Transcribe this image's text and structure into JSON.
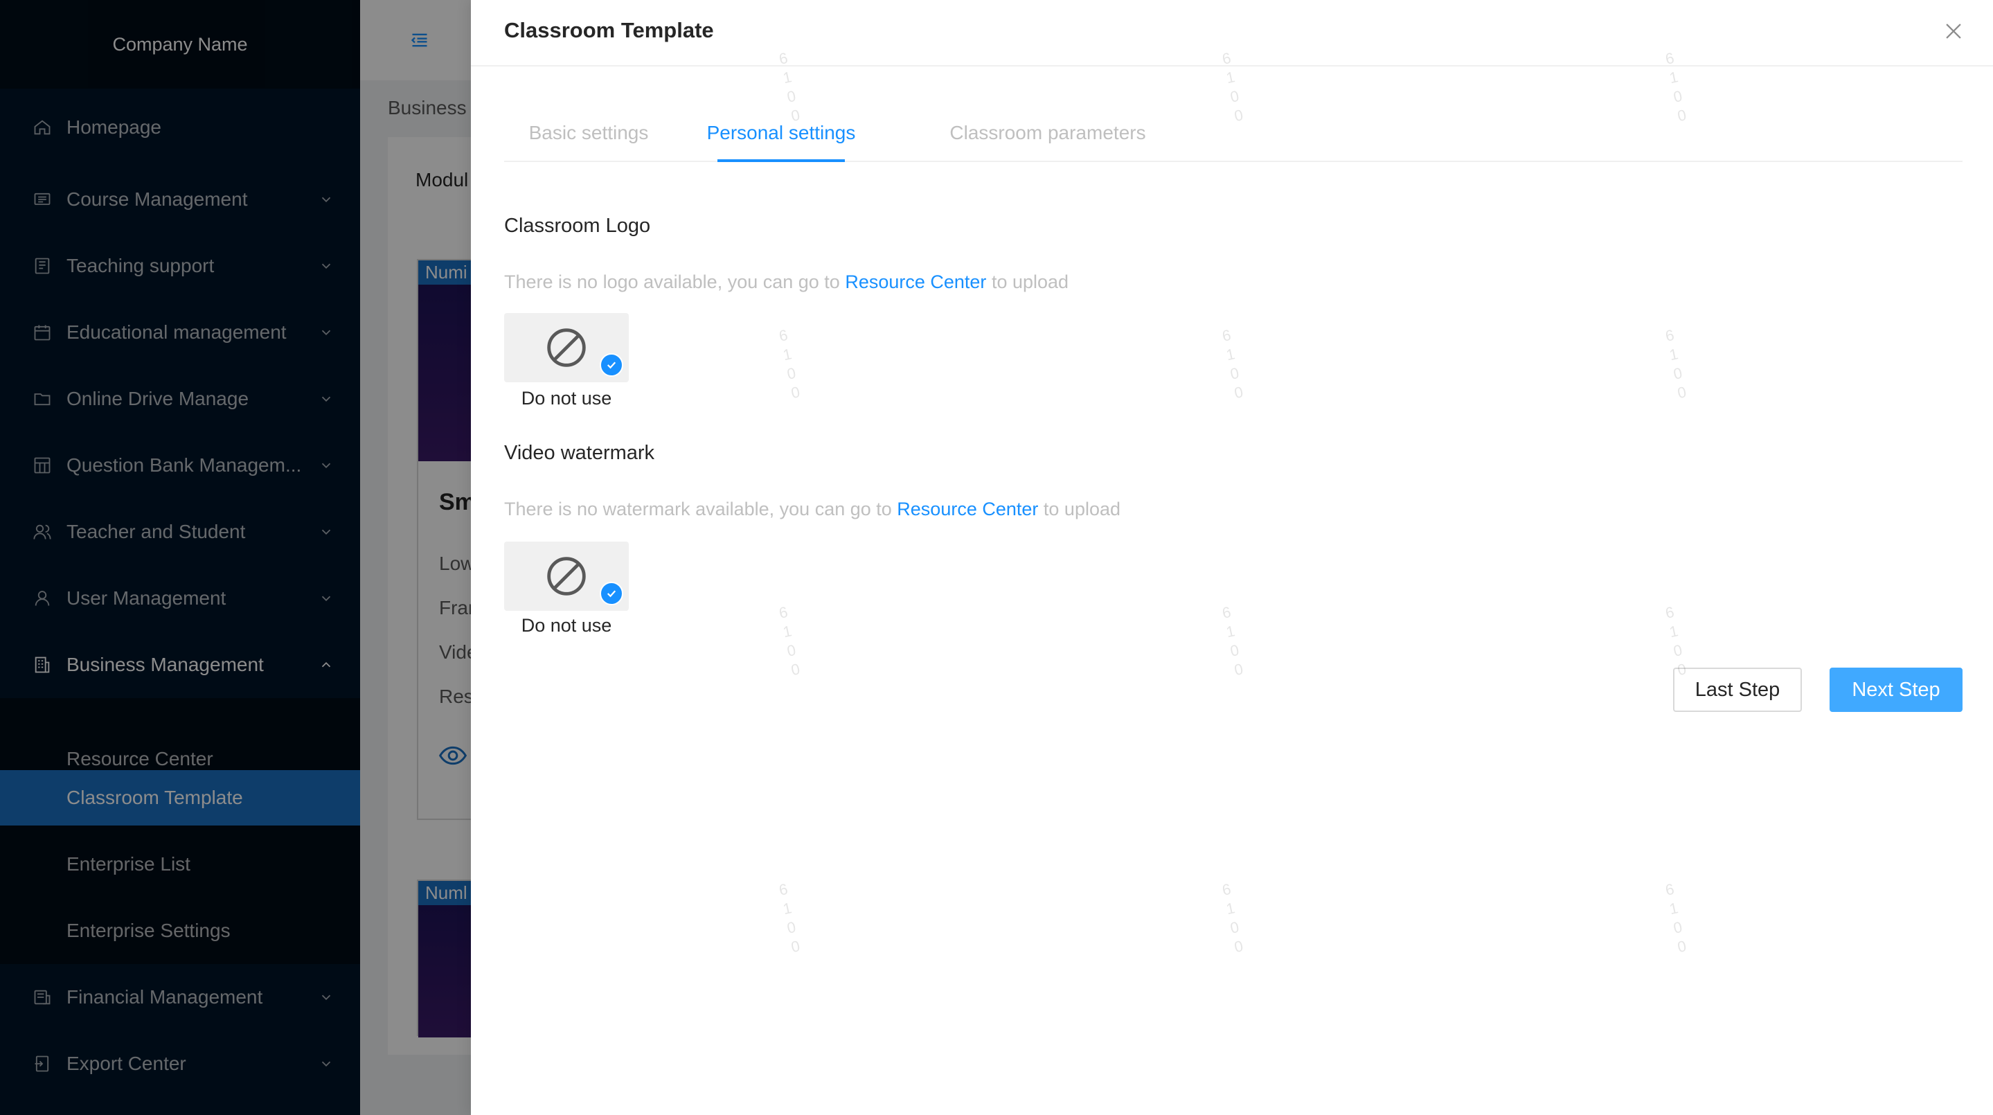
{
  "sidebar": {
    "company_name": "Company Name",
    "items": [
      {
        "label": "Homepage",
        "icon": "home-icon"
      },
      {
        "label": "Course Management",
        "icon": "course-icon"
      },
      {
        "label": "Teaching support",
        "icon": "teaching-icon"
      },
      {
        "label": "Educational management",
        "icon": "calendar-icon"
      },
      {
        "label": "Online Drive Manage",
        "icon": "folder-icon"
      },
      {
        "label": "Question Bank Managem...",
        "icon": "question-bank-icon"
      },
      {
        "label": "Teacher and Student",
        "icon": "people-icon"
      },
      {
        "label": "User Management",
        "icon": "user-icon"
      },
      {
        "label": "Business Management",
        "icon": "building-icon"
      },
      {
        "label": "Financial Management",
        "icon": "finance-icon"
      },
      {
        "label": "Export Center",
        "icon": "export-icon"
      }
    ],
    "sub_items": [
      {
        "label": "Resource Center"
      },
      {
        "label": "Classroom Template"
      },
      {
        "label": "Enterprise List"
      },
      {
        "label": "Enterprise Settings"
      }
    ]
  },
  "background": {
    "breadcrumb": "Business",
    "module_label": "Modul",
    "cards": [
      {
        "badge": "Numi",
        "title": "Sm",
        "rows": [
          "Low",
          "Frar",
          "Vide",
          "Res"
        ]
      },
      {
        "badge": "Numl"
      }
    ]
  },
  "drawer": {
    "title": "Classroom Template",
    "tabs": [
      {
        "label": "Basic settings"
      },
      {
        "label": "Personal settings"
      },
      {
        "label": "Classroom parameters"
      }
    ],
    "logo_section": {
      "title": "Classroom Logo",
      "hint_prefix": "There is no logo available, you can go to ",
      "hint_link": "Resource Center",
      "hint_suffix": " to upload",
      "option_label": "Do not use"
    },
    "watermark_section": {
      "title": "Video watermark",
      "hint_prefix": "There is no watermark available, you can go to ",
      "hint_link": "Resource Center",
      "hint_suffix": " to upload",
      "option_label": "Do not use"
    },
    "buttons": {
      "last": "Last Step",
      "next": "Next Step"
    }
  },
  "watermark_text": "6100",
  "colors": {
    "primary": "#1890ff",
    "sidebar_bg": "#011528",
    "active_menu": "#1b6fc2",
    "next_button": "#40a9ff"
  }
}
